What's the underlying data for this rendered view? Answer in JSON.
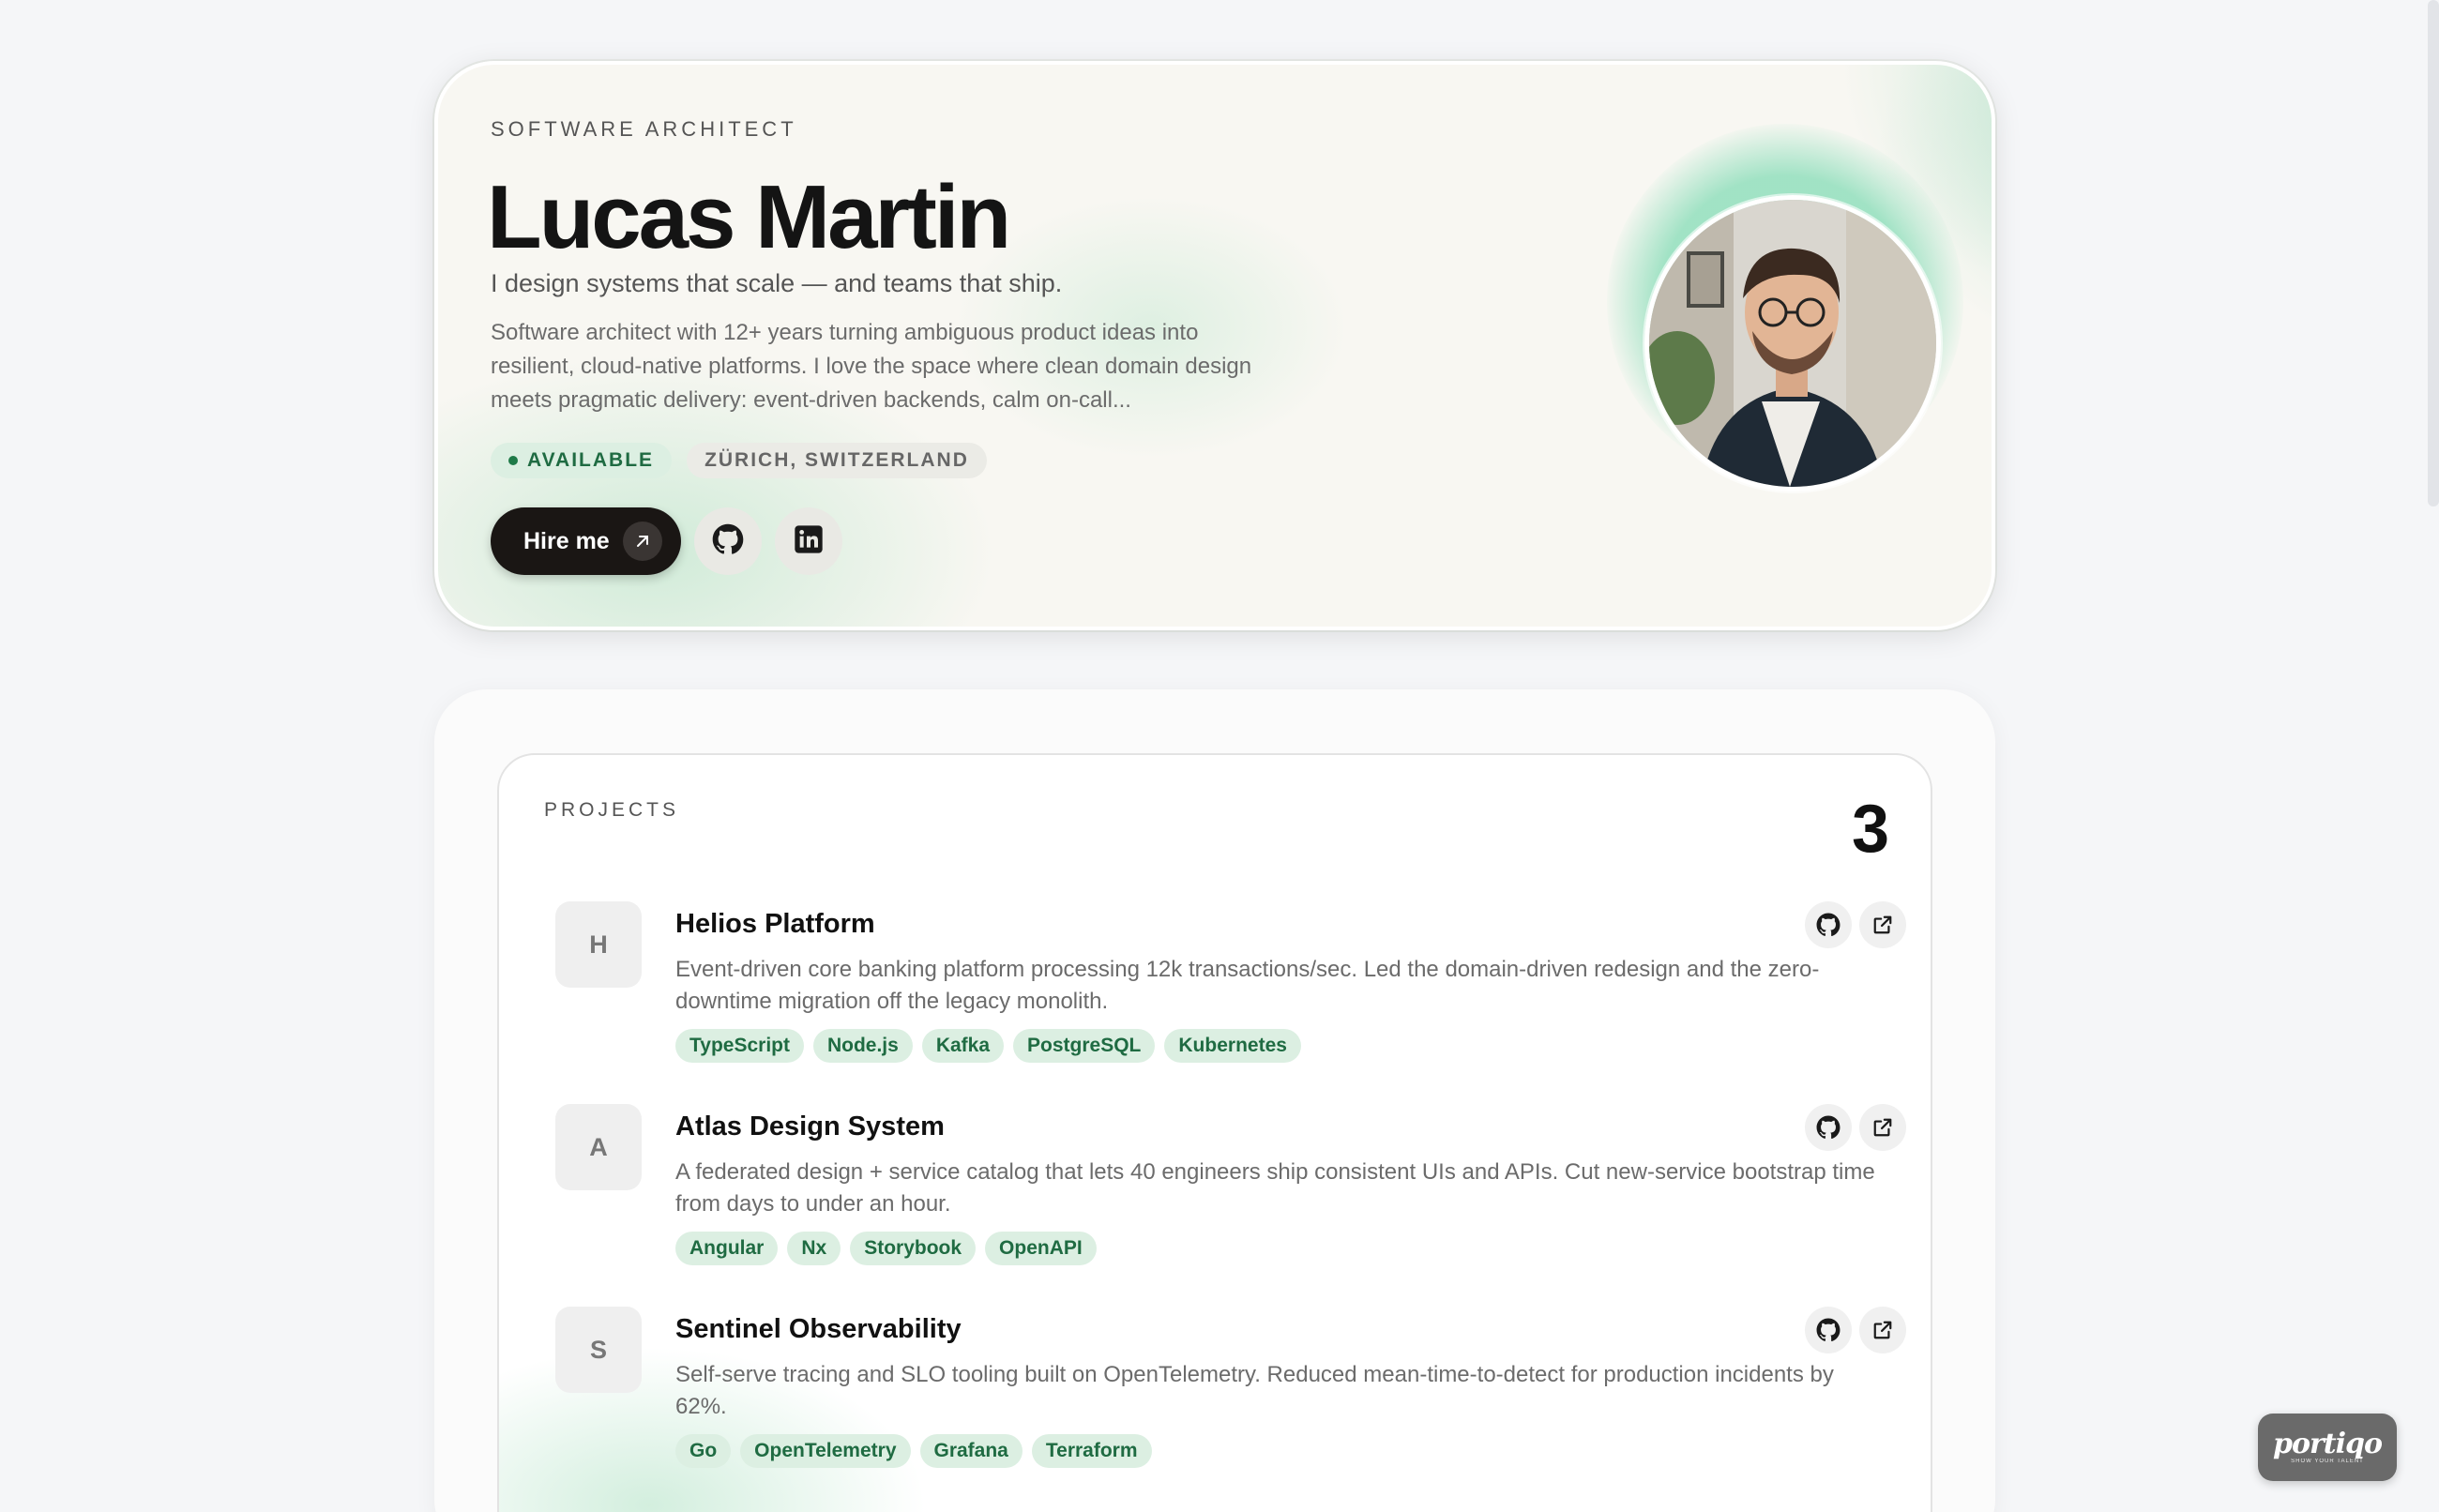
{
  "hero": {
    "eyebrow": "SOFTWARE ARCHITECT",
    "name": "Lucas Martin",
    "tagline": "I design systems that scale — and teams that ship.",
    "bio": "Software architect with 12+ years turning ambiguous product ideas into resilient, cloud-native platforms. I love the space where clean domain design meets pragmatic delivery: event-driven backends, calm on-call...",
    "badges": {
      "availability": "AVAILABLE",
      "location": "ZÜRICH, SWITZERLAND"
    },
    "actions": {
      "hire_label": "Hire me",
      "hire_icon": "arrow-up-right-icon",
      "github_icon": "github-icon",
      "linkedin_icon": "linkedin-icon"
    },
    "accent_color": "#1f6b42"
  },
  "projects": {
    "label": "PROJECTS",
    "count": "3",
    "items": [
      {
        "initial": "H",
        "title": "Helios Platform",
        "description": "Event-driven core banking platform processing 12k transactions/sec. Led the domain-driven redesign and the zero-downtime migration off the legacy monolith.",
        "tags": [
          "TypeScript",
          "Node.js",
          "Kafka",
          "PostgreSQL",
          "Kubernetes"
        ]
      },
      {
        "initial": "A",
        "title": "Atlas Design System",
        "description": "A federated design + service catalog that lets 40 engineers ship consistent UIs and APIs. Cut new-service bootstrap time from days to under an hour.",
        "tags": [
          "Angular",
          "Nx",
          "Storybook",
          "OpenAPI"
        ]
      },
      {
        "initial": "S",
        "title": "Sentinel Observability",
        "description": "Self-serve tracing and SLO tooling built on OpenTelemetry. Reduced mean-time-to-detect for production incidents by 62%.",
        "tags": [
          "Go",
          "OpenTelemetry",
          "Grafana",
          "Terraform"
        ]
      }
    ]
  },
  "brand": {
    "logo": "portiqo",
    "sub": "SHOW YOUR TALENT"
  }
}
